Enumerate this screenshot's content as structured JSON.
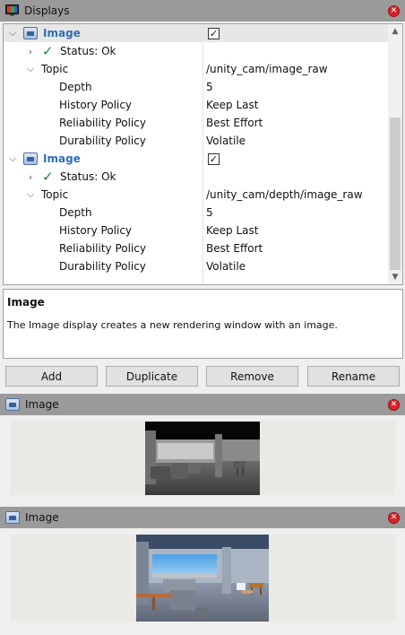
{
  "displays_panel": {
    "title": "Displays"
  },
  "tree": {
    "display1": {
      "label": "Image",
      "enabled": "✓"
    },
    "status1": {
      "label": "Status: Ok"
    },
    "topic1": {
      "label": "Topic",
      "value": "/unity_cam/image_raw"
    },
    "depth1": {
      "label": "Depth",
      "value": "5"
    },
    "history1": {
      "label": "History Policy",
      "value": "Keep Last"
    },
    "reliability1": {
      "label": "Reliability Policy",
      "value": "Best Effort"
    },
    "durability1": {
      "label": "Durability Policy",
      "value": "Volatile"
    },
    "display2": {
      "label": "Image",
      "enabled": "✓"
    },
    "status2": {
      "label": "Status: Ok"
    },
    "topic2": {
      "label": "Topic",
      "value": "/unity_cam/depth/image_raw"
    },
    "depth2": {
      "label": "Depth",
      "value": "5"
    },
    "history2": {
      "label": "History Policy",
      "value": "Keep Last"
    },
    "reliability2": {
      "label": "Reliability Policy",
      "value": "Best Effort"
    },
    "durability2": {
      "label": "Durability Policy",
      "value": "Volatile"
    }
  },
  "description": {
    "title": "Image",
    "text": "The Image display creates a new rendering window with an image."
  },
  "buttons": {
    "add": "Add",
    "duplicate": "Duplicate",
    "remove": "Remove",
    "rename": "Rename"
  },
  "image_panel_1": {
    "title": "Image"
  },
  "image_panel_2": {
    "title": "Image"
  },
  "icons": {
    "displays": "monitor-icon",
    "display_item": "image-display-icon",
    "close": "close-icon",
    "expand": "chevron-down-icon",
    "collapse": "chevron-right-icon",
    "ok": "checkmark-icon"
  },
  "colors": {
    "selected_row": "#e7e7e7",
    "display_label": "#2f6fb5",
    "ok_check": "#1b8a2a",
    "close_button": "#d9232a",
    "title_bar": "#9a9a9a"
  }
}
